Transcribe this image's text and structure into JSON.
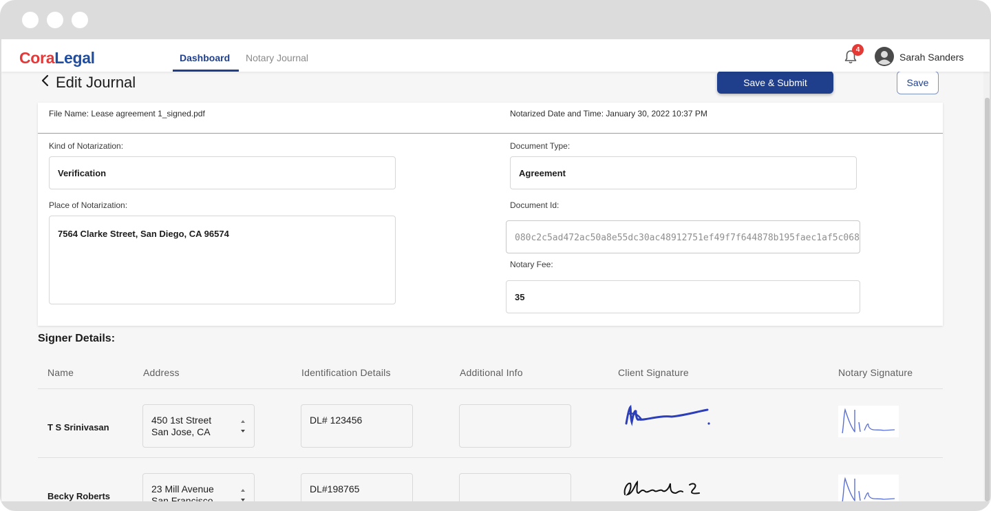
{
  "app": {
    "logo_part1": "Cora",
    "logo_part2": "Legal",
    "nav": [
      {
        "label": "Dashboard",
        "active": true
      },
      {
        "label": "Notary Journal",
        "active": false
      }
    ],
    "notification_count": "4",
    "user_name": "Sarah Sanders"
  },
  "page": {
    "title": "Edit Journal",
    "save_submit_label": "Save & Submit",
    "save_label": "Save"
  },
  "journal": {
    "file_name": "File Name: Lease agreement 1_signed.pdf",
    "notarized_datetime": "Notarized Date and Time: January 30, 2022 10:37 PM",
    "kind_label": "Kind of Notarization:",
    "kind_value": "Verification",
    "doc_type_label": "Document Type:",
    "doc_type_value": "Agreement",
    "place_label": "Place of Notarization:",
    "place_value": "7564 Clarke Street, San Diego, CA 96574",
    "doc_id_label": "Document Id:",
    "doc_id_value": "080c2c5ad472ac50a8e55dc30ac48912751ef49f7f644878b195faec1af5c068",
    "fee_label": "Notary Fee:",
    "fee_value": "35"
  },
  "signers": {
    "title": "Signer Details:",
    "columns": [
      "Name",
      "Address",
      "Identification Details",
      "Additional Info",
      "Client Signature",
      "Notary Signature"
    ],
    "rows": [
      {
        "name": "T S Srinivasan",
        "address_line1": "450 1st Street",
        "address_line2": "San Jose, CA",
        "id": "DL# 123456",
        "info": ""
      },
      {
        "name": "Becky Roberts",
        "address_line1": "23 Mill Avenue",
        "address_line2": "San Francisco",
        "id": "DL#198765",
        "info": ""
      }
    ]
  },
  "colors": {
    "brand_blue": "#1f3f8c",
    "brand_red": "#e03a3a",
    "badge_red": "#e53935"
  }
}
